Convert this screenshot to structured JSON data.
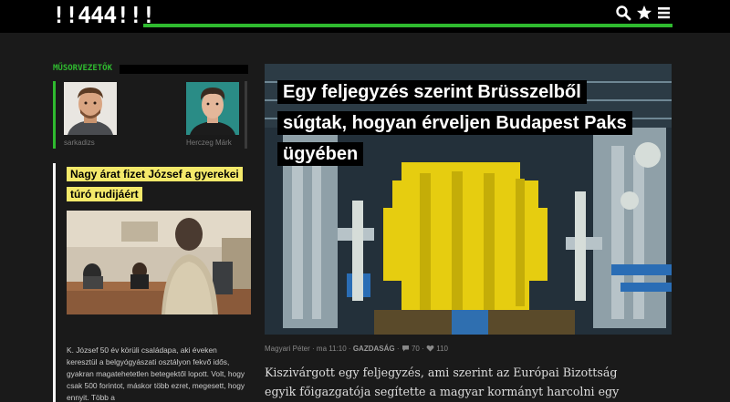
{
  "header": {
    "logo": "!!444!!!",
    "icons": [
      "search-icon",
      "star-icon",
      "menu-icon"
    ],
    "accent_color": "#2fba2f"
  },
  "sidebar": {
    "section_label": "MŰSORVEZETŐK",
    "hosts": [
      {
        "name": "sarkadizs"
      },
      {
        "name": "Herczeg Márk"
      }
    ],
    "article": {
      "title": "Nagy árat fizet József a gyerekei túró rudijáért",
      "text": "K. József 50 év körüli családapa, aki éveken keresztül a belgyógyászati osztályon fekvő idős, gyakran magatehetetlen betegektől lopott. Volt, hogy csak 500 forintot, máskor több ezret, megesett, hogy ennyit. Több a",
      "highlight_color": "#f4e96a"
    }
  },
  "main": {
    "headline": "Egy feljegyzés szerint Brüsszelből súgtak, hogyan érveljen Budapest Paks ügyében",
    "meta": {
      "author": "Magyari Péter",
      "time": "ma 11:10",
      "category": "GAZDASÁG",
      "comments": "70",
      "likes": "110"
    },
    "lead": "Kiszivárgott egy feljegyzés, ami szerint az Európai Bizottság egyik főigazgatója segítette a magyar kormányt harcolni egy másik"
  }
}
